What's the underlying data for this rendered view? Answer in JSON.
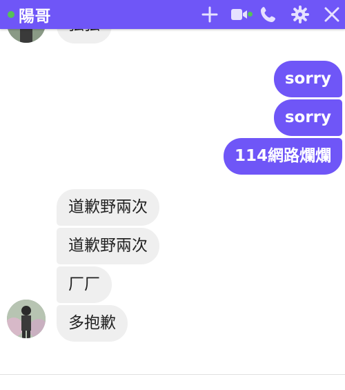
{
  "header": {
    "title": "陽哥",
    "online_color": "#56c256",
    "accent_color": "#6f56f7",
    "icons": [
      "plus-icon",
      "video-camera-icon",
      "phone-icon",
      "gear-icon",
      "close-icon"
    ]
  },
  "messages": [
    {
      "id": "m0",
      "side": "in",
      "text": "弦弦"
    },
    {
      "id": "m1",
      "side": "out",
      "text": "sorry"
    },
    {
      "id": "m2",
      "side": "out",
      "text": "sorry"
    },
    {
      "id": "m3",
      "side": "out",
      "text": "114網路爛爛"
    },
    {
      "id": "m4",
      "side": "in",
      "text": "道歉野兩次"
    },
    {
      "id": "m5",
      "side": "in",
      "text": "道歉野兩次"
    },
    {
      "id": "m6",
      "side": "in",
      "text": "厂厂"
    },
    {
      "id": "m7",
      "side": "in",
      "text": "多抱歉"
    }
  ],
  "composer": {
    "placeholder": ""
  }
}
